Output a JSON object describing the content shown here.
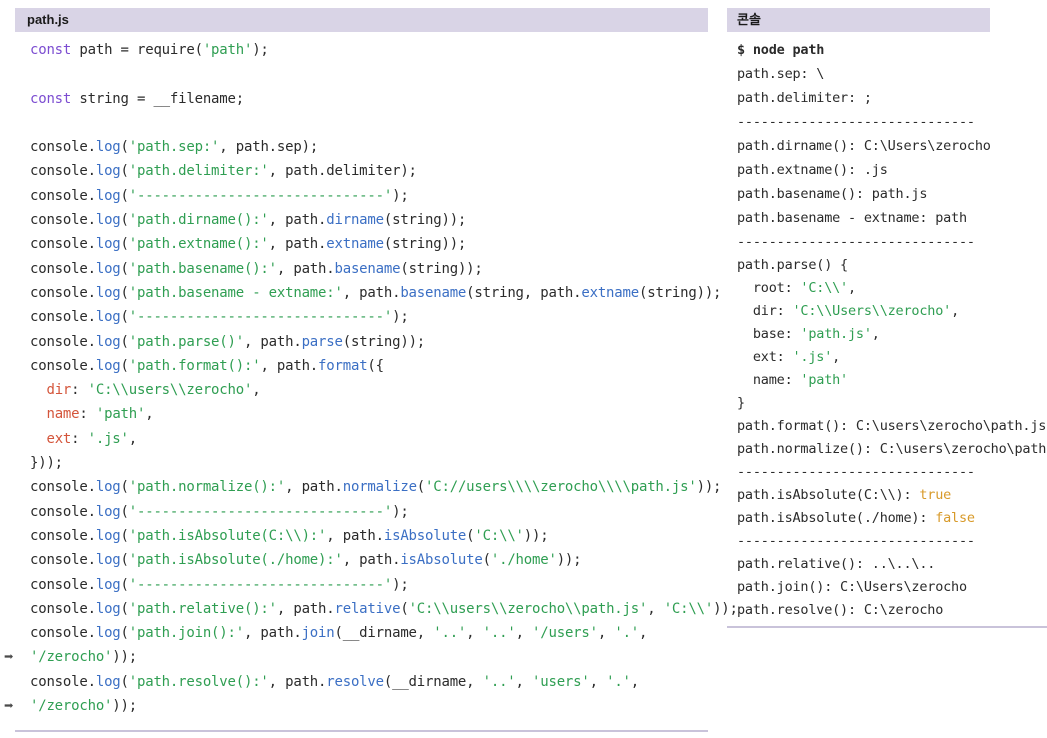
{
  "left_panel": {
    "title": "path.js",
    "code": {
      "l1_kw": "const",
      "l1_rest": " path = require(",
      "l1_str": "'path'",
      "l1_end": ");",
      "l3_kw": "const",
      "l3_rest": " string = __filename;",
      "c": "console.",
      "log": "log",
      "paren": "(",
      "s_sep": "'path.sep:'",
      "r_sep": ", path.sep);",
      "s_delim": "'path.delimiter:'",
      "r_delim": ", path.delimiter);",
      "s_dash": "'------------------------------'",
      "r_dash": ");",
      "s_dirname": "'path.dirname():'",
      "r_dirname_a": ", path.",
      "f_dirname": "dirname",
      "r_dirname_b": "(string));",
      "s_extname": "'path.extname():'",
      "r_extname_a": ", path.",
      "f_extname": "extname",
      "r_extname_b": "(string));",
      "s_basename": "'path.basename():'",
      "r_basename_a": ", path.",
      "f_basename": "basename",
      "r_basename_b": "(string));",
      "s_basename2": "'path.basename - extname:'",
      "r_b2_a": ", path.",
      "f_b2": "basename",
      "r_b2_b": "(string, path.",
      "f_b2_ext": "extname",
      "r_b2_c": "(string));",
      "s_parse": "'path.parse()'",
      "r_parse_a": ", path.",
      "f_parse": "parse",
      "r_parse_b": "(string));",
      "s_format": "'path.format():'",
      "r_format_a": ", path.",
      "f_format": "format",
      "r_format_b": "({",
      "p_dir": "dir",
      "v_dir": "'C:\\\\users\\\\zerocho'",
      "p_name": "name",
      "v_name": "'path'",
      "p_ext": "ext",
      "v_ext": "'.js'",
      "close_format": "}));",
      "s_normalize": "'path.normalize():'",
      "r_norm_a": ", path.",
      "f_norm": "normalize",
      "v_norm": "'C://users\\\\\\\\zerocho\\\\\\\\path.js'",
      "r_norm_b": "));",
      "s_isabs1": "'path.isAbsolute(C:\\\\):'",
      "r_isabs1_a": ", path.",
      "f_isabs1": "isAbsolute",
      "v_isabs1": "'C:\\\\'",
      "r_isabs1_b": "));",
      "s_isabs2": "'path.isAbsolute(./home):'",
      "r_isabs2_a": ", path.",
      "f_isabs2": "isAbsolute",
      "v_isabs2": "'./home'",
      "r_isabs2_b": "));",
      "s_relative": "'path.relative():'",
      "r_rel_a": ", path.",
      "f_rel": "relative",
      "v_rel1": "'C:\\\\users\\\\zerocho\\\\path.js'",
      "v_rel2": "'C:\\\\'",
      "r_rel_b": "));",
      "s_join": "'path.join():'",
      "r_join_a": ", path.",
      "f_join": "join",
      "r_join_b": "(__dirname, ",
      "v_j1": "'..'",
      "v_j2": "'..'",
      "v_j3": "'/users'",
      "v_j4": "'.'",
      "v_j5": "'/zerocho'",
      "r_join_c": "));",
      "s_resolve": "'path.resolve():'",
      "r_res_a": ", path.",
      "f_res": "resolve",
      "r_res_b": "(__dirname, ",
      "v_r1": "'..'",
      "v_r2": "'users'",
      "v_r3": "'.'",
      "v_r4": "'/zerocho'",
      "r_res_c": "));",
      "comma": ", ",
      "arrow_glyph": "➡"
    }
  },
  "right_panel": {
    "title": "콘솔",
    "out": {
      "cmd": "$ node path",
      "sep": "path.sep: \\",
      "delim": "path.delimiter: ;",
      "dash": "------------------------------",
      "dirname": "path.dirname(): C:\\Users\\zerocho",
      "extname": "path.extname(): .js",
      "basename": "path.basename(): path.js",
      "basename2": "path.basename - extname: path",
      "parse_open": "path.parse() {",
      "root_k": "  root: ",
      "root_v": "'C:\\\\'",
      "root_c": ",",
      "dir_k": "  dir: ",
      "dir_v": "'C:\\\\Users\\\\zerocho'",
      "dir_c": ",",
      "base_k": "  base: ",
      "base_v": "'path.js'",
      "base_c": ",",
      "ext_k": "  ext: ",
      "ext_v": "'.js'",
      "ext_c": ",",
      "name_k": "  name: ",
      "name_v": "'path'",
      "parse_close": "}",
      "format": "path.format(): C:\\users\\zerocho\\path.js",
      "normalize": "path.normalize(): C:\\users\\zerocho\\path.js",
      "isabs1_k": "path.isAbsolute(C:\\\\): ",
      "isabs1_v": "true",
      "isabs2_k": "path.isAbsolute(./home): ",
      "isabs2_v": "false",
      "relative": "path.relative(): ..\\..\\..",
      "join": "path.join(): C:\\Users\\zerocho",
      "resolve": "path.resolve(): C:\\zerocho"
    }
  }
}
